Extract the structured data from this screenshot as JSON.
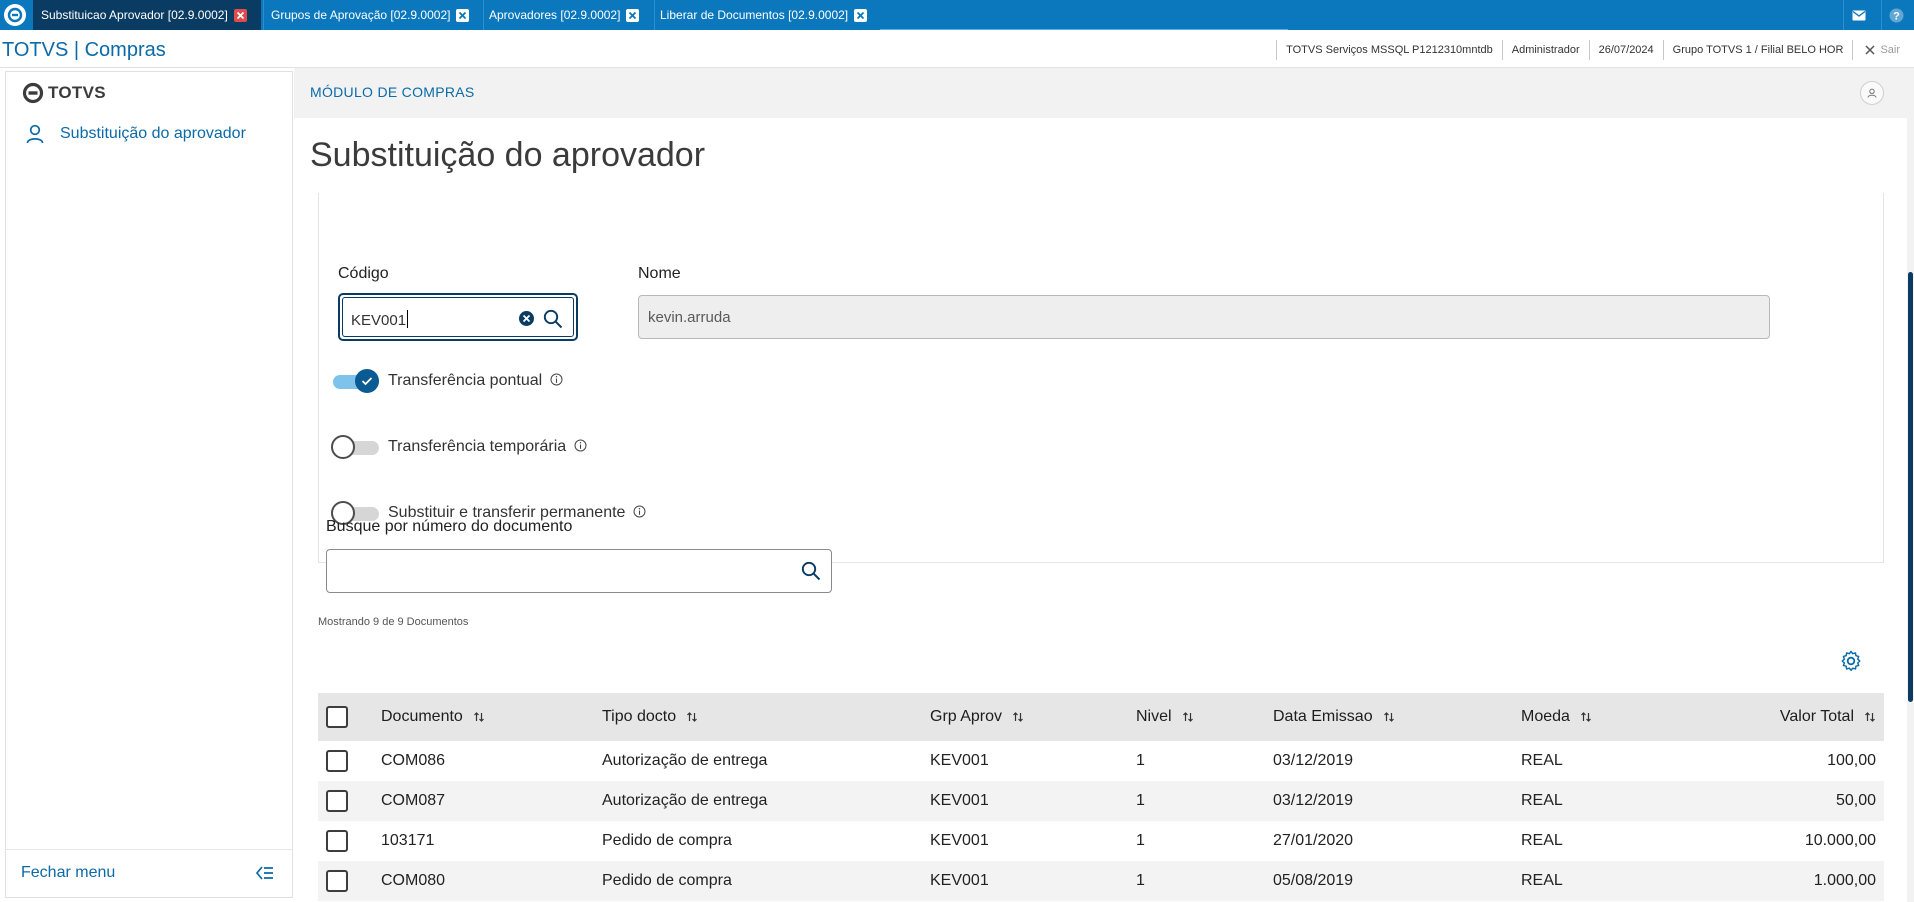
{
  "tabs": [
    {
      "label": "Substituicao Aprovador [02.9.0002]",
      "active": true
    },
    {
      "label": "Grupos de Aprovação [02.9.0002]",
      "active": false
    },
    {
      "label": "Aprovadores [02.9.0002]",
      "active": false
    },
    {
      "label": "Liberar de Documentos [02.9.0002]",
      "active": false
    }
  ],
  "header": {
    "app_title": "TOTVS | Compras",
    "server": "TOTVS Serviços MSSQL P1212310mntdb",
    "user": "Administrador",
    "date": "26/07/2024",
    "branch": "Grupo TOTVS 1 / Filial BELO HOR",
    "exit_label": "Sair"
  },
  "sidebar": {
    "brand": "TOTVS",
    "items": [
      {
        "label": "Substituição do aprovador",
        "icon": "user-icon"
      }
    ],
    "close_menu": "Fechar menu"
  },
  "module": {
    "title": "MÓDULO DE COMPRAS"
  },
  "page": {
    "title": "Substituição do aprovador"
  },
  "form": {
    "code_label": "Código",
    "code_value": "KEV001",
    "name_label": "Nome",
    "name_value": "kevin.arruda",
    "toggles": [
      {
        "label": "Transferência pontual",
        "on": true
      },
      {
        "label": "Transferência temporária",
        "on": false
      },
      {
        "label": "Substituir e transferir permanente",
        "on": false
      }
    ]
  },
  "search": {
    "label": "Busque por número do documento",
    "value": ""
  },
  "results": {
    "showing": "Mostrando 9 de 9 Documentos"
  },
  "table": {
    "columns": [
      "Documento",
      "Tipo docto",
      "Grp Aprov",
      "Nivel",
      "Data Emissao",
      "Moeda",
      "Valor Total"
    ],
    "rows": [
      [
        "COM086",
        "Autorização de entrega",
        "KEV001",
        "1",
        "03/12/2019",
        "REAL",
        "100,00"
      ],
      [
        "COM087",
        "Autorização de entrega",
        "KEV001",
        "1",
        "03/12/2019",
        "REAL",
        "50,00"
      ],
      [
        "103171",
        "Pedido de compra",
        "KEV001",
        "1",
        "27/01/2020",
        "REAL",
        "10.000,00"
      ],
      [
        "COM080",
        "Pedido de compra",
        "KEV001",
        "1",
        "05/08/2019",
        "REAL",
        "1.000,00"
      ]
    ]
  },
  "colors": {
    "primary": "#0b78bd",
    "dark": "#0a3c63",
    "link": "#0b6aa8"
  }
}
